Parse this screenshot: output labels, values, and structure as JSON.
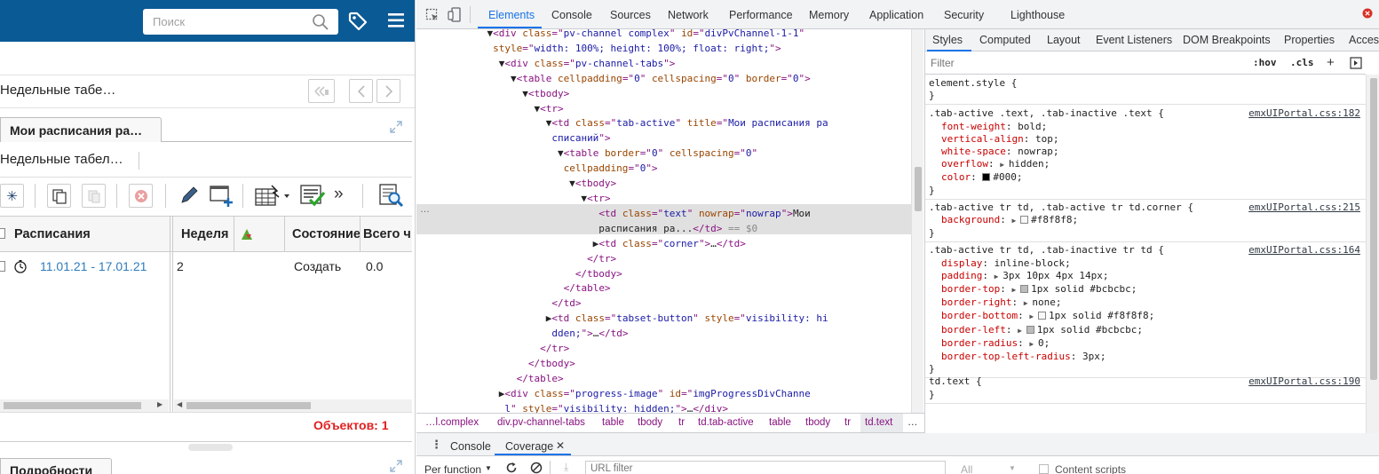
{
  "app": {
    "search": {
      "placeholder": "Поиск"
    },
    "panel_title": "Недельные табе…",
    "tab_active": "Мои расписания ра…",
    "subtitle": "Недельные табел…",
    "toolbar": {
      "more": "»"
    },
    "grid": {
      "headers": [
        "Расписания",
        "Неделя",
        "Состояние",
        "Всего ч"
      ],
      "row": {
        "period": "11.01.21 - 17.01.21",
        "week": "2",
        "state": "Создать",
        "total": "0.0"
      }
    },
    "objects_count": "Объектов: 1",
    "bottom_tab": "Подробности"
  },
  "devtools": {
    "tabs": [
      "Elements",
      "Console",
      "Sources",
      "Network",
      "Performance",
      "Memory",
      "Application",
      "Security",
      "Lighthouse"
    ],
    "active_tab": "Elements",
    "ellipsis": "…",
    "eq": "== $0",
    "styles_tabs": [
      "Styles",
      "Computed",
      "Layout",
      "Event Listeners",
      "DOM Breakpoints",
      "Properties",
      "Access"
    ],
    "filter_placeholder": "Filter",
    "hov": ":hov",
    "cls": ".cls",
    "breadcrumbs": [
      "…l.complex",
      "div.pv-channel-tabs",
      "table",
      "tbody",
      "tr",
      "td.tab-active",
      "table",
      "tbody",
      "tr",
      "td.text",
      "…"
    ],
    "drawer_tabs": {
      "console": "Console",
      "coverage": "Coverage"
    },
    "coverage": {
      "per_function": "Per function",
      "url_placeholder": "URL filter",
      "all": "All",
      "content_scripts": "Content scripts"
    },
    "rules": [
      {
        "selector": "element.style {",
        "source": "",
        "props": []
      },
      {
        "selector": ".tab-active .text, .tab-inactive .text {",
        "source": "emxUIPortal.css:182",
        "props": [
          {
            "n": "font-weight",
            "v": "bold;"
          },
          {
            "n": "vertical-align",
            "v": "top;"
          },
          {
            "n": "white-space",
            "v": "nowrap;"
          },
          {
            "n": "overflow",
            "v": "hidden;"
          },
          {
            "n": "color",
            "v": "#000;"
          }
        ]
      },
      {
        "selector": ".tab-active tr td, .tab-active tr td.corner {",
        "source": "emxUIPortal.css:215",
        "props": [
          {
            "n": "background",
            "v": "#f8f8f8;"
          }
        ]
      },
      {
        "selector": ".tab-active tr td, .tab-inactive tr td {",
        "source": "emxUIPortal.css:164",
        "props": [
          {
            "n": "display",
            "v": "inline-block;"
          },
          {
            "n": "padding",
            "v": "3px 10px 4px 14px;"
          },
          {
            "n": "border-top",
            "v": "1px solid #bcbcbc;"
          },
          {
            "n": "border-right",
            "v": "none;"
          },
          {
            "n": "border-bottom",
            "v": "1px solid #f8f8f8;"
          },
          {
            "n": "border-left",
            "v": "1px solid #bcbcbc;"
          },
          {
            "n": "border-radius",
            "v": "0;"
          },
          {
            "n": "border-top-left-radius",
            "v": "3px;"
          }
        ]
      },
      {
        "selector": "td.text {",
        "source": "emxUIPortal.css:190",
        "props": []
      }
    ],
    "colors": {
      "accent": "#1a73e8",
      "app_blue": "#0a5a96",
      "red_count": "#e02020"
    }
  }
}
